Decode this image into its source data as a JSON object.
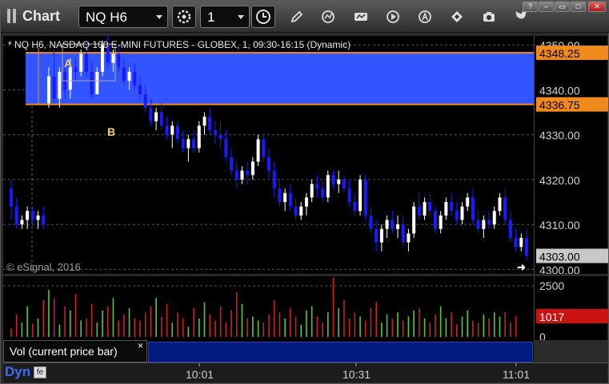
{
  "app": {
    "title": "Chart"
  },
  "toolbar": {
    "symbol": "NQ H6",
    "interval": "1"
  },
  "chart": {
    "info_line": "* NQ H6, NASDAQ 100 E-MINI FUTURES - GLOBEX, 1, 09:30-16:15 (Dynamic)",
    "copyright": "© eSignal, 2016",
    "label_a": "A",
    "label_b": "B",
    "upper_level_label": "4348.25",
    "lower_level_label": "4336.75",
    "last_price_label": "4303.00"
  },
  "volume": {
    "study_label": "Vol (current price bar)",
    "close_glyph": "×",
    "last_volume_label": "1017"
  },
  "footer": {
    "mode": "Dyn"
  },
  "colors": {
    "band": "#3355ff",
    "level_line": "#f08a1c",
    "up_bar": "#ffffff",
    "down_bar": "#1a1aff",
    "vol_up": "#55cc33",
    "vol_down": "#cc2222"
  },
  "chart_data": {
    "type": "candlestick",
    "price_axis": {
      "ticks": [
        "4350.00",
        "4340.00",
        "4330.00",
        "4320.00",
        "4310.00",
        "4300.00"
      ],
      "range": [
        4299,
        4352
      ]
    },
    "volume_axis": {
      "ticks": [
        "2500",
        "0"
      ],
      "range": [
        0,
        2500
      ]
    },
    "time_axis": {
      "ticks": [
        "10:01",
        "10:31",
        "11:01"
      ]
    },
    "levels": [
      4348.25,
      4336.75
    ],
    "last_price": 4303.0,
    "last_volume": 1017,
    "candles": [
      [
        4318,
        4320,
        4311,
        4314
      ],
      [
        4314,
        4316,
        4309,
        4310
      ],
      [
        4310,
        4312,
        4309,
        4311
      ],
      [
        4311,
        4314,
        4309,
        4313
      ],
      [
        4313,
        4314,
        4310,
        4311
      ],
      [
        4311,
        4313,
        4309,
        4312
      ],
      [
        4312,
        4314,
        4309,
        4310
      ],
      [
        4337,
        4345,
        4336,
        4343
      ],
      [
        4343,
        4349,
        4337,
        4338
      ],
      [
        4338,
        4345,
        4336,
        4344
      ],
      [
        4344,
        4346,
        4338,
        4340
      ],
      [
        4340,
        4347,
        4338,
        4345
      ],
      [
        4345,
        4347,
        4342,
        4344
      ],
      [
        4344,
        4349,
        4343,
        4348
      ],
      [
        4348,
        4350,
        4343,
        4344
      ],
      [
        4344,
        4346,
        4338,
        4339
      ],
      [
        4339,
        4345,
        4339,
        4344
      ],
      [
        4344,
        4351,
        4343,
        4350
      ],
      [
        4350,
        4352,
        4345,
        4346
      ],
      [
        4346,
        4349,
        4344,
        4348
      ],
      [
        4348,
        4350,
        4344,
        4345
      ],
      [
        4345,
        4347,
        4341,
        4342
      ],
      [
        4342,
        4345,
        4340,
        4344
      ],
      [
        4344,
        4346,
        4340,
        4341
      ],
      [
        4341,
        4343,
        4338,
        4339
      ],
      [
        4339,
        4341,
        4335,
        4336
      ],
      [
        4336,
        4338,
        4332,
        4333
      ],
      [
        4333,
        4336,
        4331,
        4335
      ],
      [
        4335,
        4337,
        4331,
        4332
      ],
      [
        4332,
        4334,
        4329,
        4330
      ],
      [
        4330,
        4333,
        4327,
        4332
      ],
      [
        4332,
        4333,
        4328,
        4329
      ],
      [
        4329,
        4331,
        4326,
        4327
      ],
      [
        4327,
        4330,
        4324,
        4329
      ],
      [
        4329,
        4331,
        4326,
        4327
      ],
      [
        4327,
        4333,
        4326,
        4332
      ],
      [
        4332,
        4335,
        4330,
        4334
      ],
      [
        4334,
        4336,
        4330,
        4331
      ],
      [
        4331,
        4333,
        4328,
        4330
      ],
      [
        4330,
        4333,
        4327,
        4329
      ],
      [
        4329,
        4331,
        4324,
        4325
      ],
      [
        4325,
        4327,
        4321,
        4322
      ],
      [
        4322,
        4324,
        4318,
        4320
      ],
      [
        4320,
        4323,
        4319,
        4322
      ],
      [
        4322,
        4324,
        4319,
        4321
      ],
      [
        4321,
        4325,
        4320,
        4324
      ],
      [
        4324,
        4330,
        4323,
        4329
      ],
      [
        4329,
        4330,
        4324,
        4325
      ],
      [
        4325,
        4327,
        4320,
        4322
      ],
      [
        4322,
        4324,
        4316,
        4318
      ],
      [
        4318,
        4320,
        4314,
        4315
      ],
      [
        4315,
        4318,
        4313,
        4317
      ],
      [
        4317,
        4319,
        4313,
        4314
      ],
      [
        4314,
        4316,
        4311,
        4312
      ],
      [
        4312,
        4315,
        4311,
        4314
      ],
      [
        4314,
        4317,
        4312,
        4316
      ],
      [
        4316,
        4320,
        4315,
        4319
      ],
      [
        4319,
        4321,
        4316,
        4318
      ],
      [
        4318,
        4320,
        4315,
        4316
      ],
      [
        4316,
        4322,
        4315,
        4321
      ],
      [
        4321,
        4322,
        4318,
        4319
      ],
      [
        4319,
        4322,
        4317,
        4320
      ],
      [
        4320,
        4321,
        4317,
        4318
      ],
      [
        4318,
        4320,
        4314,
        4315
      ],
      [
        4315,
        4317,
        4312,
        4313
      ],
      [
        4313,
        4321,
        4312,
        4320
      ],
      [
        4320,
        4321,
        4311,
        4312
      ],
      [
        4312,
        4314,
        4308,
        4309
      ],
      [
        4309,
        4311,
        4304,
        4306
      ],
      [
        4306,
        4310,
        4304,
        4309
      ],
      [
        4309,
        4312,
        4307,
        4311
      ],
      [
        4311,
        4313,
        4308,
        4309
      ],
      [
        4309,
        4312,
        4307,
        4310
      ],
      [
        4310,
        4312,
        4305,
        4306
      ],
      [
        4306,
        4309,
        4304,
        4308
      ],
      [
        4308,
        4315,
        4307,
        4314
      ],
      [
        4314,
        4317,
        4311,
        4312
      ],
      [
        4312,
        4316,
        4311,
        4315
      ],
      [
        4315,
        4317,
        4312,
        4313
      ],
      [
        4313,
        4314,
        4308,
        4309
      ],
      [
        4309,
        4313,
        4308,
        4312
      ],
      [
        4312,
        4316,
        4311,
        4315
      ],
      [
        4315,
        4317,
        4312,
        4313
      ],
      [
        4313,
        4315,
        4310,
        4311
      ],
      [
        4311,
        4315,
        4310,
        4314
      ],
      [
        4314,
        4317,
        4313,
        4316
      ],
      [
        4316,
        4318,
        4310,
        4311
      ],
      [
        4311,
        4313,
        4308,
        4309
      ],
      [
        4309,
        4312,
        4307,
        4311
      ],
      [
        4311,
        4313,
        4309,
        4310
      ],
      [
        4310,
        4314,
        4309,
        4313
      ],
      [
        4313,
        4317,
        4312,
        4316
      ],
      [
        4316,
        4318,
        4310,
        4311
      ],
      [
        4311,
        4313,
        4306,
        4307
      ],
      [
        4307,
        4309,
        4304,
        4305
      ],
      [
        4305,
        4308,
        4304,
        4307
      ],
      [
        4307,
        4309,
        4302,
        4303
      ]
    ],
    "volume": [
      420,
      1100,
      700,
      1500,
      650,
      900,
      1800,
      2300,
      1900,
      600,
      1500,
      1300,
      2100,
      800,
      900,
      1600,
      700,
      1300,
      1500,
      1900,
      800,
      1100,
      1400,
      900,
      800,
      1200,
      1500,
      1900,
      1000,
      1600,
      700,
      1200,
      900,
      500,
      1400,
      900,
      1700,
      1100,
      800,
      1500,
      700,
      1300,
      2200,
      1600,
      900,
      1000,
      800,
      700,
      1100,
      1800,
      1200,
      900,
      1400,
      1000,
      600,
      1300,
      1500,
      1000,
      700,
      1200,
      2900,
      1400,
      1800,
      900,
      1200,
      1000,
      800,
      1400,
      1700,
      700,
      1100,
      900,
      1200,
      800,
      1000,
      1300,
      1400,
      900,
      700,
      1100,
      1500,
      900,
      1200,
      600,
      1000,
      1300,
      800,
      700,
      1100,
      900,
      1200,
      1000,
      1200,
      700,
      1017
    ]
  }
}
